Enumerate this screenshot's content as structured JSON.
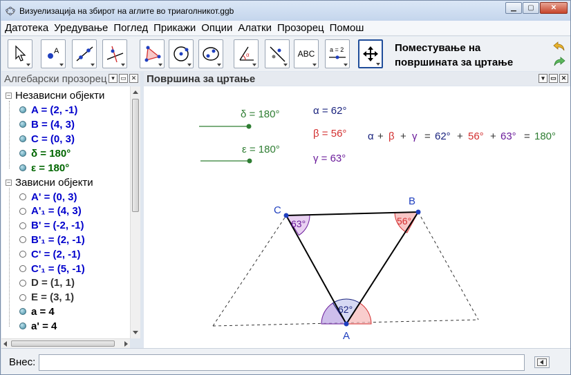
{
  "window": {
    "title": "Визуелизација на збирот на аглите во триаголникот.ggb"
  },
  "menu": [
    "Датотека",
    "Уредување",
    "Поглед",
    "Прикажи",
    "Опции",
    "Алатки",
    "Прозорец",
    "Помош"
  ],
  "toolbar": {
    "tools": [
      "move-tool-icon",
      "point-tool-icon",
      "line-tool-icon",
      "perpendicular-tool-icon",
      "polygon-tool-icon",
      "circle-tool-icon",
      "conic-tool-icon",
      "angle-tool-icon",
      "reflect-tool-icon",
      "text-tool-icon",
      "slider-tool-icon",
      "move-graphics-tool-icon"
    ],
    "text_tool_label": "ABC",
    "slider_tool_label": "a = 2",
    "active_tool_description": "Поместување на површината за цртање"
  },
  "algebra": {
    "title": "Алгебарски прозорец",
    "groups": [
      {
        "label": "Независни објекти",
        "items": [
          {
            "text": "A = (2, -1)",
            "color": "#0000cc",
            "filled": true
          },
          {
            "text": "B = (4, 3)",
            "color": "#0000cc",
            "filled": true
          },
          {
            "text": "C = (0, 3)",
            "color": "#0000cc",
            "filled": true
          },
          {
            "text": "δ = 180°",
            "color": "#006600",
            "filled": true
          },
          {
            "text": "ε = 180°",
            "color": "#006600",
            "filled": true
          }
        ]
      },
      {
        "label": "Зависни објекти",
        "items": [
          {
            "text": "A' = (0, 3)",
            "color": "#0000cc",
            "filled": false
          },
          {
            "text": "A'₁ = (4, 3)",
            "color": "#0000cc",
            "filled": false
          },
          {
            "text": "B' = (-2, -1)",
            "color": "#0000cc",
            "filled": false
          },
          {
            "text": "B'₁ = (2, -1)",
            "color": "#0000cc",
            "filled": false
          },
          {
            "text": "C' = (2, -1)",
            "color": "#0000cc",
            "filled": false
          },
          {
            "text": "C'₁ = (5, -1)",
            "color": "#0000cc",
            "filled": false
          },
          {
            "text": "D = (1, 1)",
            "color": "#333333",
            "filled": false
          },
          {
            "text": "E = (3, 1)",
            "color": "#333333",
            "filled": false
          },
          {
            "text": "a = 4",
            "color": "#000000",
            "filled": true
          },
          {
            "text": "a' = 4",
            "color": "#000000",
            "filled": true
          }
        ]
      }
    ]
  },
  "graphics": {
    "title": "Површина за цртање",
    "slider_delta": "δ = 180°",
    "slider_epsilon": "ε = 180°",
    "alpha": "α = 62°",
    "beta": "β = 56°",
    "gamma": "γ = 63°",
    "eq_alpha": "α",
    "eq_beta": "β",
    "eq_gamma": "γ",
    "plus": "+",
    "equals": "=",
    "eq_v1": "62°",
    "eq_v2": "56°",
    "eq_v3": "63°",
    "eq_sum": "180°",
    "label_A": "A",
    "label_B": "B",
    "label_C": "C",
    "angle_A": "62°",
    "angle_B": "56°",
    "angle_C": "63°",
    "colors": {
      "alpha": "#1a237e",
      "beta": "#d32f2f",
      "gamma": "#6a1b9a",
      "slider": "#2e7d32",
      "point": "#1f3fbf"
    }
  },
  "input": {
    "label": "Внес:",
    "value": ""
  }
}
